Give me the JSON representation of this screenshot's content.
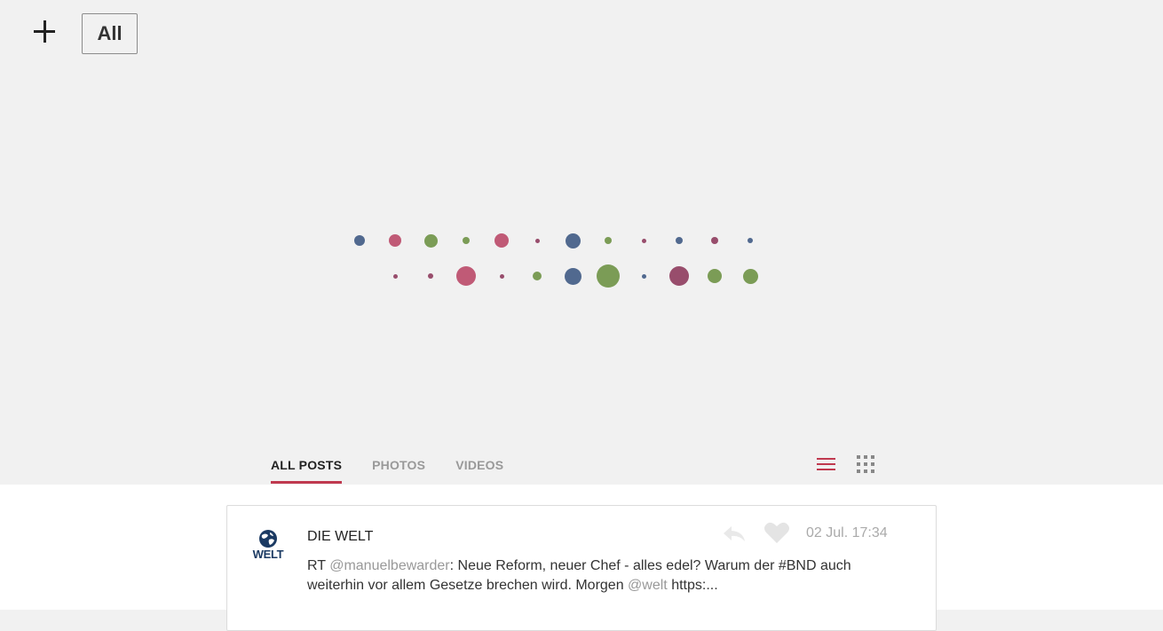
{
  "toolbar": {
    "add_icon": "plus-icon",
    "filter_label": "All"
  },
  "loading_dots": {
    "colors": {
      "blue": "#51698f",
      "rose": "#c05a76",
      "green": "#7b9c56",
      "plum": "#984d6c"
    }
  },
  "tabs": [
    {
      "label": "ALL POSTS",
      "active": true
    },
    {
      "label": "PHOTOS",
      "active": false
    },
    {
      "label": "VIDEOS",
      "active": false
    }
  ],
  "view_modes": {
    "list": {
      "icon": "list-icon",
      "active": true
    },
    "grid": {
      "icon": "grid-icon",
      "active": false
    }
  },
  "accent_color": "#c0394f",
  "posts": [
    {
      "author": "DIE WELT",
      "logo_text": "WELT",
      "timestamp": "02 Jul. 17:34",
      "reply_icon": "reply-icon",
      "like_icon": "heart-icon",
      "text_prefix": "RT ",
      "mention_1": "@manuelbewarder",
      "text_middle": ": Neue Reform, neuer Chef - alles edel? Warum der #BND auch weiterhin vor allem Gesetze brechen wird. Morgen ",
      "mention_2": "@welt",
      "text_suffix": " https:..."
    }
  ]
}
